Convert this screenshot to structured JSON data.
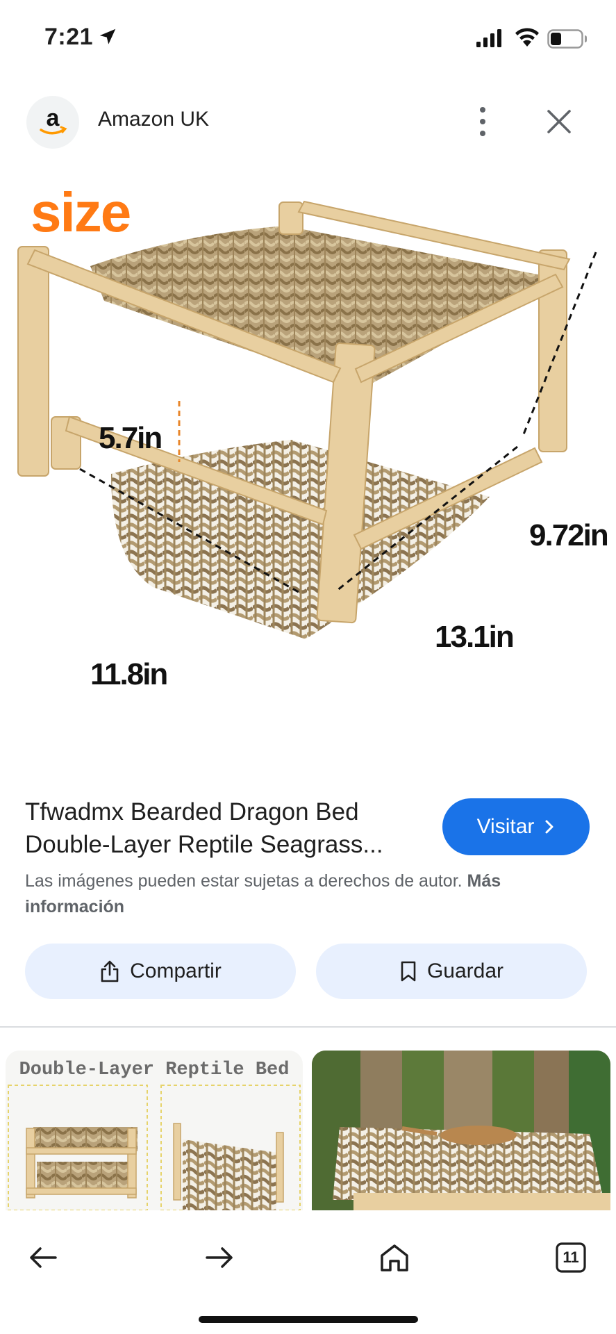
{
  "status_bar": {
    "time": "7:21",
    "icons": [
      "location-arrow-icon",
      "cellular-signal-icon",
      "wifi-icon",
      "battery-icon"
    ]
  },
  "source": {
    "avatar_letter": "a",
    "name": "Amazon UK"
  },
  "image": {
    "size_label": "size",
    "dimensions": {
      "height": "5.7in",
      "depth": "9.72in",
      "width": "13.1in",
      "length": "11.8in"
    }
  },
  "product": {
    "title_line1": "Tfwadmx Bearded Dragon Bed",
    "title_line2": "Double-Layer Reptile Seagrass..."
  },
  "visit_button": {
    "label": "Visitar"
  },
  "copyright": {
    "text": "Las imágenes pueden estar sujetas a derechos de autor.",
    "link": "Más información"
  },
  "actions": {
    "share_label": "Compartir",
    "save_label": "Guardar"
  },
  "related": {
    "item1_caption": "Double-Layer Reptile Bed"
  },
  "nav": {
    "tab_count": "11"
  },
  "colors": {
    "accent_blue": "#1a73e8",
    "chip_bg": "#e8f0fe",
    "size_orange": "#ff7a14",
    "amazon_orange": "#ff9900"
  }
}
